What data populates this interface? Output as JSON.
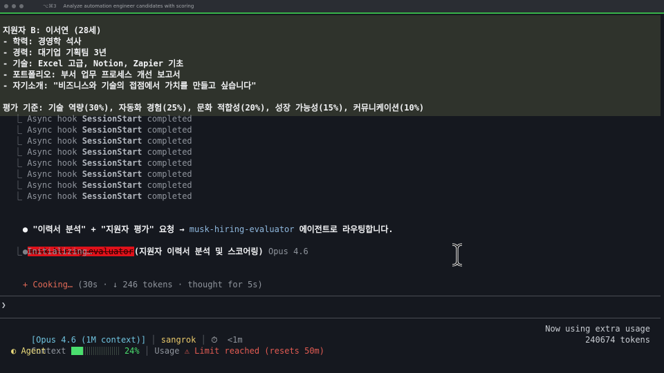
{
  "window": {
    "shortcut": "⌥⌘3",
    "title": "Analyze automation engineer candidates with scoring"
  },
  "candidate": {
    "header": "지원자 B: 이서연 (28세)",
    "education": "- 학력: 경영학 석사",
    "experience": "- 경력: 대기업 기획팀 3년",
    "skills": "- 기술: Excel 고급, Notion, Zapier 기초",
    "portfolio": "- 포트폴리오: 부서 업무 프로세스 개선 보고서",
    "intro": "- 자기소개: \"비즈니스와 기술의 접점에서 가치를 만들고 싶습니다\""
  },
  "criteria": "평가 기준: 기술 역량(30%), 자동화 경험(25%), 문화 적합성(20%), 성장 가능성(15%), 커뮤니케이션(10%)",
  "hooks": {
    "prefix": "⎿ Async hook ",
    "name": "SessionStart",
    "suffix": " completed",
    "count": 8
  },
  "routing": {
    "bullet": "●",
    "text_before": " \"이력서 분석\" + \"지원자 평가\" 요청 → ",
    "agent": "musk-hiring-evaluator",
    "text_after": " 에이전트로 라우팅합니다."
  },
  "task": {
    "bullet": "●",
    "agent_badge": "musk-hiring-evaluator",
    "description": "(지원자 이력서 분석 및 스코어링)",
    "model": "Opus 4.6",
    "status": "⎿ Initializing…"
  },
  "cooking": {
    "label": "+ Cooking…",
    "meta": " (30s · ↓ 246 tokens · thought for 5s)"
  },
  "prompt_symbol": "❯",
  "status": {
    "model": "[Opus 4.6 (1M context)]",
    "user": "sangrok",
    "timer_icon": "⏱",
    "timer": "<1m",
    "context_label": "Context",
    "context_pct": "24%",
    "context_value": 0.24,
    "usage_label": "Usage",
    "limit_text": "⚠ Limit reached (resets 50m)",
    "extra_usage": "Now using extra usage",
    "tokens": "240674 tokens",
    "agent": "◐ Agent"
  },
  "colors": {
    "accent_green": "#39b54a",
    "badge_red": "#e0111a",
    "agent_blue": "#8fb8de",
    "cook_orange": "#e26a57"
  }
}
